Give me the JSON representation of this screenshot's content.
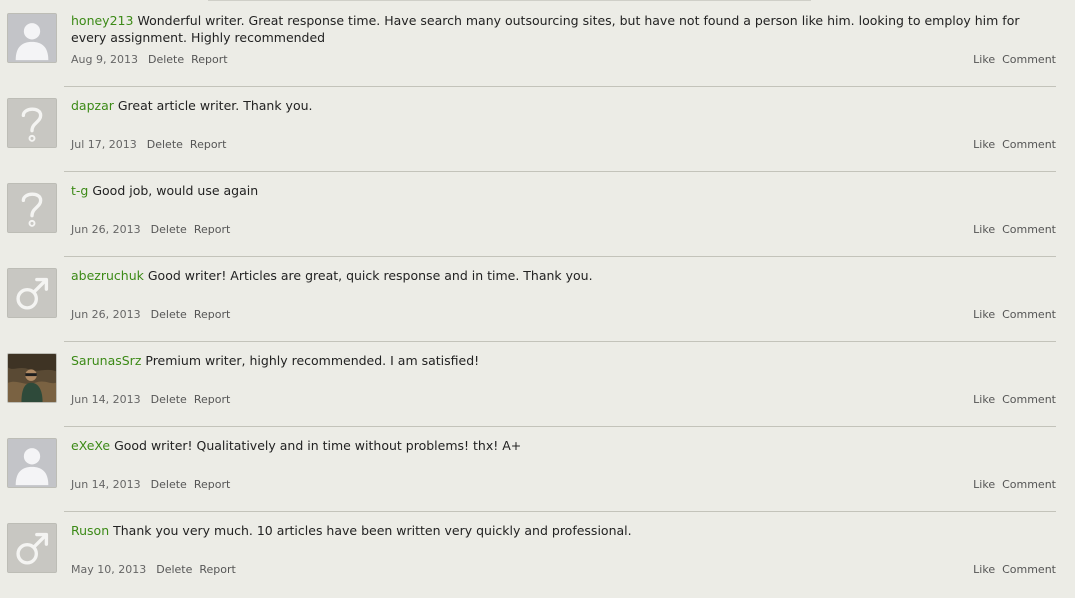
{
  "labels": {
    "delete": "Delete",
    "report": "Report",
    "like": "Like",
    "comment": "Comment"
  },
  "comments": [
    {
      "user": "honey213",
      "text": "Wonderful writer. Great response time. Have search many outsourcing sites, but have not found a person like him. looking to employ him for every assignment. Highly recommended",
      "date": "Aug 9, 2013",
      "avatar": "default-person-icon"
    },
    {
      "user": "dapzar",
      "text": "Great article writer. Thank you.",
      "date": "Jul 17, 2013",
      "avatar": "question-mark-icon"
    },
    {
      "user": "t-g",
      "text": "Good job, would use again",
      "date": "Jun 26, 2013",
      "avatar": "question-mark-icon"
    },
    {
      "user": "abezruchuk",
      "text": "Good writer! Articles are great, quick response and in time. Thank you.",
      "date": "Jun 26, 2013",
      "avatar": "male-symbol-icon"
    },
    {
      "user": "SarunasSrz",
      "text": "Premium writer, highly recommended. I am satisfied!",
      "date": "Jun 14, 2013",
      "avatar": "user-photo"
    },
    {
      "user": "eXeXe",
      "text": "Good writer! Qualitatively and in time without problems! thx! A+",
      "date": "Jun 14, 2013",
      "avatar": "default-person-icon"
    },
    {
      "user": "Ruson",
      "text": "Thank you very much. 10 articles have been written very quickly and professional.",
      "date": "May 10, 2013",
      "avatar": "male-symbol-icon"
    }
  ]
}
